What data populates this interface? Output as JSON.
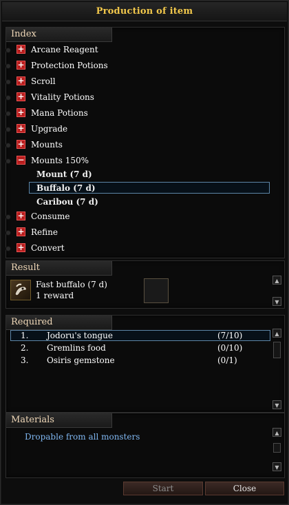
{
  "window": {
    "title": "Production of item"
  },
  "index": {
    "tab": "Index",
    "items": [
      {
        "label": "Arcane Reagent",
        "expanded": false
      },
      {
        "label": "Protection Potions",
        "expanded": false
      },
      {
        "label": "Scroll",
        "expanded": false
      },
      {
        "label": "Vitality Potions",
        "expanded": false
      },
      {
        "label": "Mana Potions",
        "expanded": false
      },
      {
        "label": "Upgrade",
        "expanded": false
      },
      {
        "label": "Mounts",
        "expanded": false
      },
      {
        "label": "Mounts 150%",
        "expanded": true,
        "children": [
          "Mount (7 d)",
          "Buffalo (7 d)",
          "Caribou (7 d)"
        ],
        "selected_child": "Buffalo (7 d)"
      },
      {
        "label": "Consume",
        "expanded": false
      },
      {
        "label": "Refine",
        "expanded": false
      },
      {
        "label": "Convert",
        "expanded": false
      }
    ]
  },
  "result": {
    "tab": "Result",
    "item_name": "Fast buffalo (7 d)",
    "reward_text": "1 reward"
  },
  "required": {
    "tab": "Required",
    "rows": [
      {
        "num": "1.",
        "name": "Jodoru's tongue",
        "count": "(7/10)"
      },
      {
        "num": "2.",
        "name": "Gremlins food",
        "count": "(0/10)"
      },
      {
        "num": "3.",
        "name": "Osiris gemstone",
        "count": "(0/1)"
      }
    ]
  },
  "materials": {
    "tab": "Materials",
    "text": "Dropable from all monsters"
  },
  "buttons": {
    "start": "Start",
    "close": "Close"
  }
}
